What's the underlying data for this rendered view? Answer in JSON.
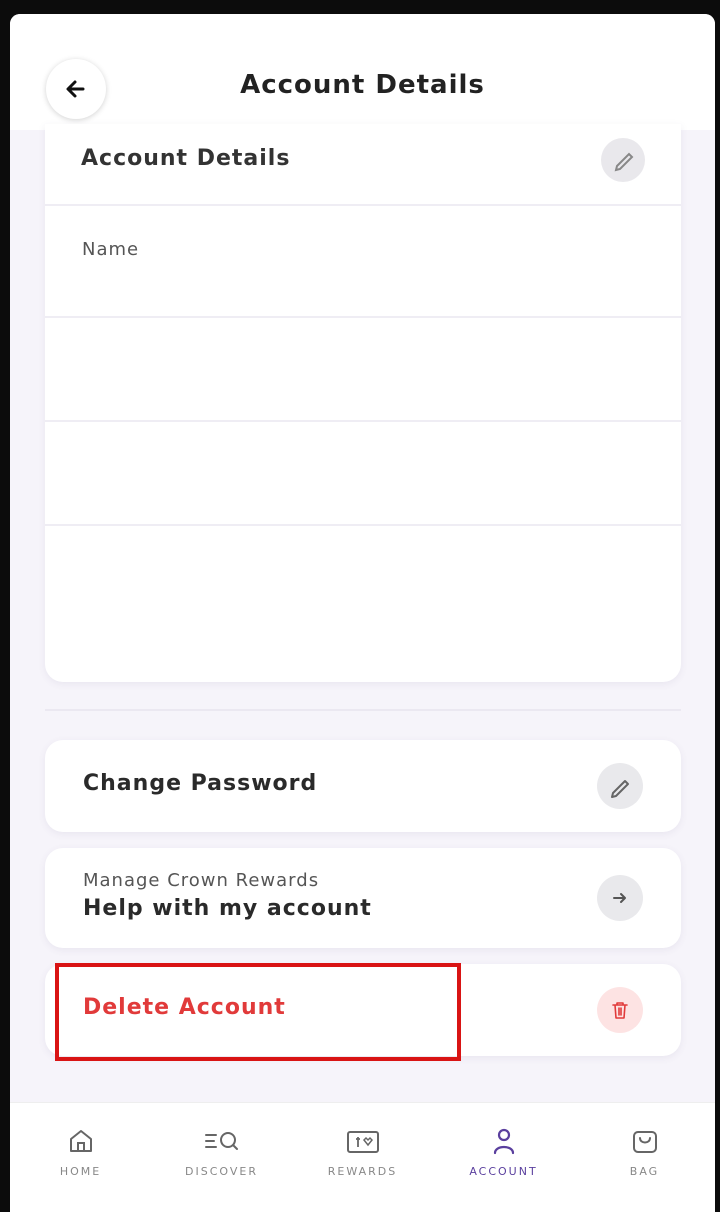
{
  "header": {
    "title": "Account Details",
    "back_icon": "arrow-left-icon"
  },
  "details_card": {
    "heading": "Account Details",
    "edit_icon": "pencil-icon",
    "name_label": "Name"
  },
  "actions": {
    "change_password": {
      "label": "Change Password",
      "icon": "pencil-icon"
    },
    "manage_rewards": {
      "subtitle": "Manage Crown Rewards",
      "label": "Help with my account",
      "icon": "arrow-right-icon"
    },
    "delete_account": {
      "label": "Delete Account",
      "icon": "trash-icon",
      "color": "#e13a3a"
    }
  },
  "bottom_nav": {
    "items": [
      {
        "label": "HOME",
        "icon": "home-icon"
      },
      {
        "label": "DISCOVER",
        "icon": "discover-icon"
      },
      {
        "label": "REWARDS",
        "icon": "rewards-icon"
      },
      {
        "label": "ACCOUNT",
        "icon": "account-icon"
      },
      {
        "label": "BAG",
        "icon": "bag-icon"
      }
    ],
    "active": "ACCOUNT",
    "active_color": "#5a3f9e"
  },
  "colors": {
    "background": "#f6f4fa",
    "highlight": "#d91414",
    "danger": "#e13a3a"
  }
}
